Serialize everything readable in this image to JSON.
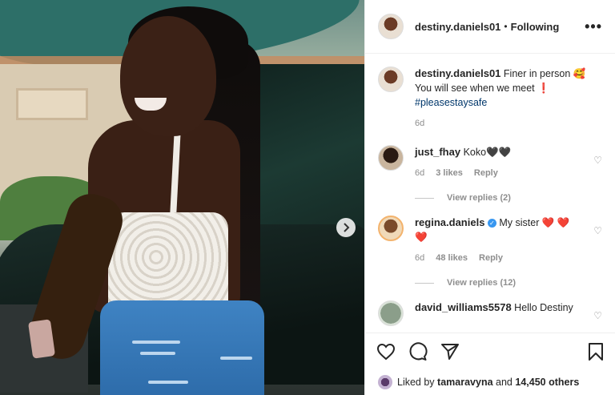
{
  "post": {
    "username": "destiny.daniels01",
    "separator": "•",
    "follow_status": "Following",
    "more_label": "•••"
  },
  "caption": {
    "username": "destiny.daniels01",
    "text_line1": "Finer in person 🥰",
    "text_line2": "You will see when we meet ❗",
    "hashtag": "#pleasestaysafe",
    "age": "6d"
  },
  "comments": [
    {
      "username": "just_fhay",
      "text": "Koko🖤🖤",
      "age": "6d",
      "likes": "3 likes",
      "reply": "Reply",
      "views": "View replies (2)"
    },
    {
      "username": "regina.daniels",
      "text_before": "My sister",
      "hearts": "❤️ ❤️",
      "heart2": "❤️",
      "age": "6d",
      "likes": "48 likes",
      "reply": "Reply",
      "views": "View replies (12)"
    },
    {
      "username": "david_williams5578",
      "text": "Hello Destiny"
    }
  ],
  "footer": {
    "liked_by_prefix": "Liked by",
    "liked_by_user": "tamaravyna",
    "liked_by_and": "and",
    "others": "14,450 others"
  },
  "icons": {
    "next": "chevron-right",
    "like": "heart-outline",
    "comment": "speech-bubble",
    "share": "paper-plane",
    "save": "bookmark"
  },
  "colors": {
    "link": "#00376b",
    "verified": "#3897f0",
    "heart": "#d0122d"
  }
}
